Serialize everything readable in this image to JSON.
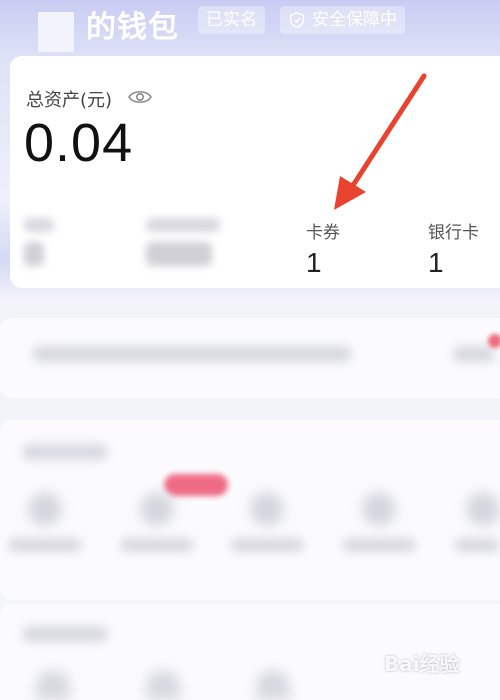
{
  "header": {
    "title": "的钱包",
    "verified_tag": "已实名",
    "security_tag": "安全保障中"
  },
  "assets": {
    "label": "总资产(元)",
    "value": "0.04"
  },
  "stats": [
    {
      "label": "",
      "value": ""
    },
    {
      "label": "",
      "value": ""
    },
    {
      "label": "卡券",
      "value": "1"
    },
    {
      "label": "银行卡",
      "value": "1"
    }
  ],
  "colors": {
    "arrow": "#e8432e",
    "header_gradient_top": "#c8ccf2"
  },
  "icons": {
    "eye": "eye-icon",
    "shield": "shield-icon"
  },
  "watermark": "Bai经验"
}
